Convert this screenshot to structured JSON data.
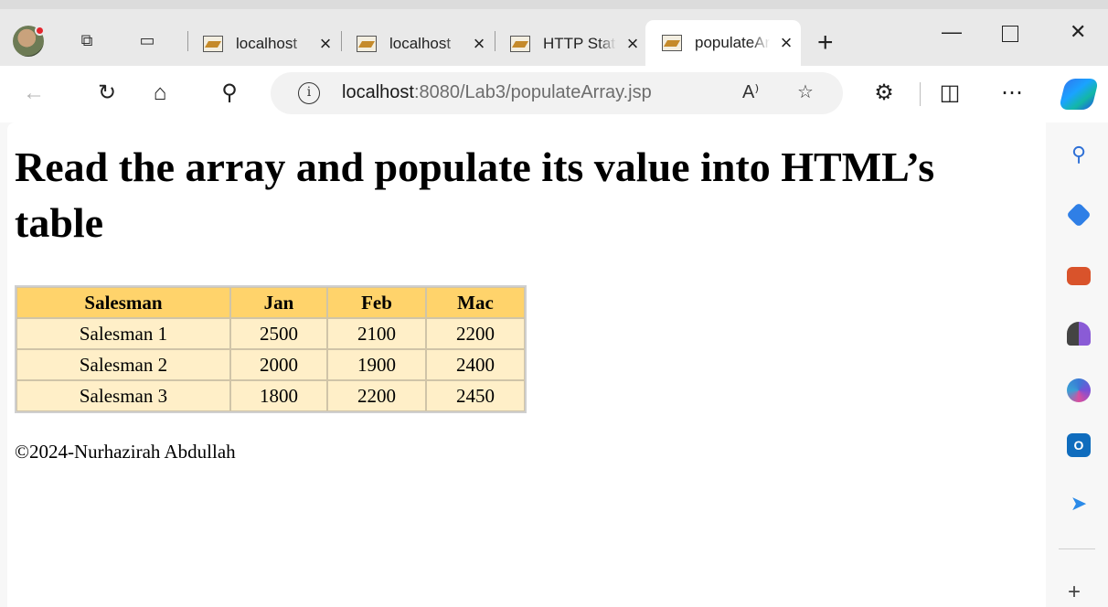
{
  "browser": {
    "tabs": [
      {
        "title": "localhost",
        "active": false
      },
      {
        "title": "localhost",
        "active": false
      },
      {
        "title": "HTTP Status",
        "active": false
      },
      {
        "title": "populateArray",
        "active": true
      }
    ],
    "url_host": "localhost",
    "url_path": ":8080/Lab3/populateArray.jsp",
    "icons": {
      "back": "back-arrow-icon",
      "refresh": "refresh-icon",
      "home": "home-icon",
      "search": "search-icon",
      "info": "info-icon",
      "read_aloud": "read-aloud-icon",
      "favorite": "star-icon",
      "extensions": "extensions-icon",
      "split_screen": "split-screen-icon",
      "more": "more-icon",
      "copilot": "copilot-icon"
    },
    "sidebar_icons": [
      "search-icon",
      "shopping-tag-icon",
      "tools-icon",
      "games-icon",
      "microsoft365-icon",
      "outlook-icon",
      "send-icon",
      "add-icon"
    ]
  },
  "page": {
    "heading": "Read the array and populate its value into HTML’s table",
    "table": {
      "headers": [
        "Salesman",
        "Jan",
        "Feb",
        "Mac"
      ],
      "rows": [
        [
          "Salesman 1",
          "2500",
          "2100",
          "2200"
        ],
        [
          "Salesman 2",
          "2000",
          "1900",
          "2400"
        ],
        [
          "Salesman 3",
          "1800",
          "2200",
          "2450"
        ]
      ]
    },
    "footer": "©2024-Nurhazirah Abdullah"
  },
  "colors": {
    "header_bg": "#ffd36b",
    "cell_bg": "#ffefc8"
  }
}
